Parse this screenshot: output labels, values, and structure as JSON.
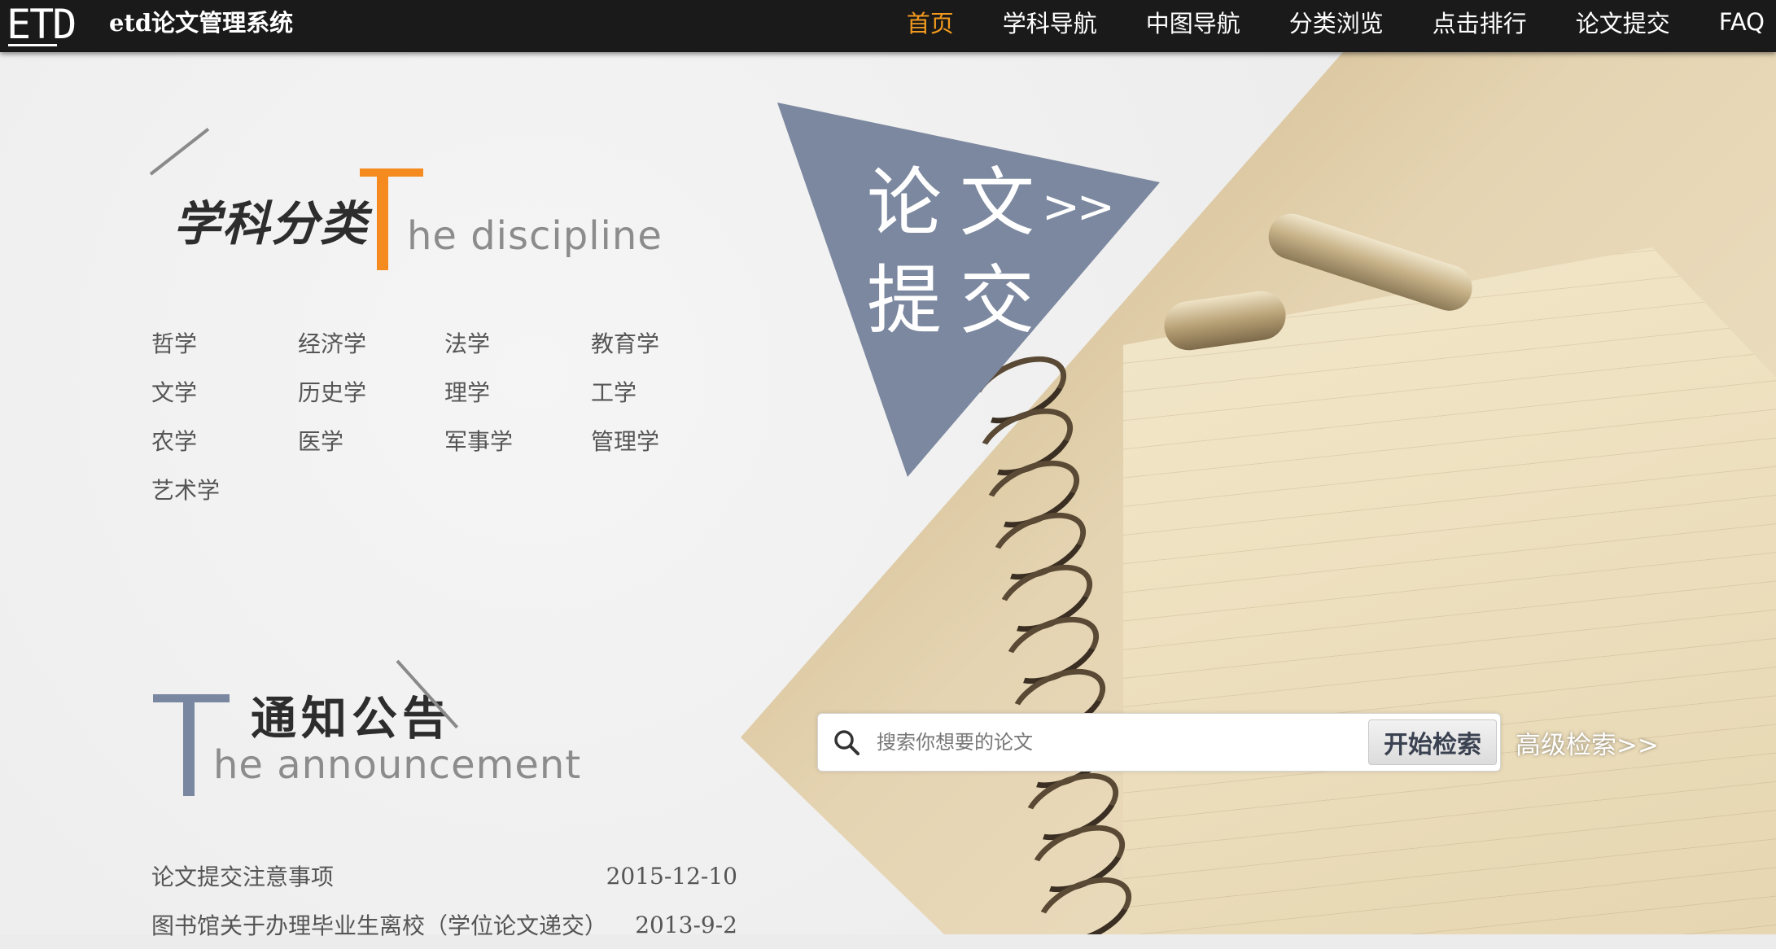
{
  "header": {
    "logo_text": "ETD",
    "app_name": "etd论文管理系统",
    "nav": [
      {
        "label": "首页",
        "active": true
      },
      {
        "label": "学科导航",
        "active": false
      },
      {
        "label": "中图导航",
        "active": false
      },
      {
        "label": "分类浏览",
        "active": false
      },
      {
        "label": "点击排行",
        "active": false
      },
      {
        "label": "论文提交",
        "active": false
      },
      {
        "label": "FAQ",
        "active": false
      }
    ],
    "colors": {
      "bar_bg": "#1a1a1a",
      "active_nav": "#f39a1e",
      "nav_text": "#ffffff"
    }
  },
  "discipline": {
    "heading_cn": "学科分类",
    "heading_en": "he discipline",
    "accent_color": "#f58a1f",
    "items": [
      "哲学",
      "经济学",
      "法学",
      "教育学",
      "文学",
      "历史学",
      "理学",
      "工学",
      "农学",
      "医学",
      "军事学",
      "管理学",
      "艺术学"
    ]
  },
  "announcement": {
    "heading_cn": "通知公告",
    "heading_en": "he announcement",
    "accent_color": "#7a87a0",
    "items": [
      {
        "title": "论文提交注意事项",
        "date": "2015-12-10"
      },
      {
        "title": "图书馆关于办理毕业生离校（学位论文递交）",
        "date": "2013-9-2"
      }
    ]
  },
  "submit_banner": {
    "line1": "论文",
    "arrows": ">>",
    "line2": "提交",
    "color": "#7c889f"
  },
  "search": {
    "placeholder": "搜索你想要的论文",
    "button_label": "开始检索",
    "advanced_label": "高级检索>>",
    "icon": "search-icon"
  }
}
